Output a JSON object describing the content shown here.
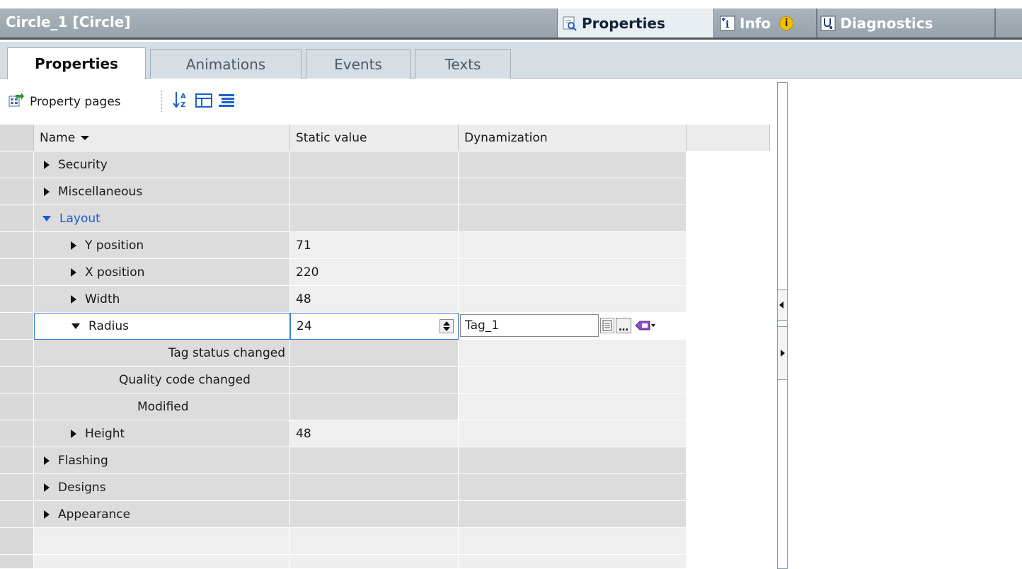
{
  "titlebar": {
    "title": "Circle_1 [Circle]",
    "tabs": [
      {
        "label": "Properties",
        "icon": "properties-inspector-icon"
      },
      {
        "label": "Info",
        "icon": "info-icon",
        "badge": "i"
      },
      {
        "label": "Diagnostics",
        "icon": "diagnostics-icon"
      }
    ]
  },
  "subtabs": [
    "Properties",
    "Animations",
    "Events",
    "Texts"
  ],
  "toolbar": {
    "property_pages_label": "Property pages",
    "icons": [
      "sort-az-icon",
      "collapse-icon",
      "expand-all-icon"
    ]
  },
  "grid": {
    "headers": {
      "name": "Name",
      "static_value": "Static value",
      "dynamization": "Dynamization"
    },
    "rows": [
      {
        "name": "Security",
        "value": "",
        "dyn": ""
      },
      {
        "name": "Miscellaneous",
        "value": "",
        "dyn": ""
      },
      {
        "name": "Layout",
        "value": "",
        "dyn": ""
      },
      {
        "name": "Y position",
        "value": "71",
        "dyn": ""
      },
      {
        "name": "X position",
        "value": "220",
        "dyn": ""
      },
      {
        "name": "Width",
        "value": "48",
        "dyn": ""
      },
      {
        "name": "Radius",
        "value": "24",
        "dyn": "Tag_1"
      },
      {
        "name": "Tag status changed",
        "value": "",
        "dyn": ""
      },
      {
        "name": "Quality code changed",
        "value": "",
        "dyn": ""
      },
      {
        "name": "Modified",
        "value": "",
        "dyn": ""
      },
      {
        "name": "Height",
        "value": "48",
        "dyn": ""
      },
      {
        "name": "Flashing",
        "value": "",
        "dyn": ""
      },
      {
        "name": "Designs",
        "value": "",
        "dyn": ""
      },
      {
        "name": "Appearance",
        "value": "",
        "dyn": ""
      }
    ]
  },
  "colors": {
    "accent": "#1a5fd0",
    "titlebar": "#9aa4ad",
    "selection_border": "#3b7cd9"
  }
}
